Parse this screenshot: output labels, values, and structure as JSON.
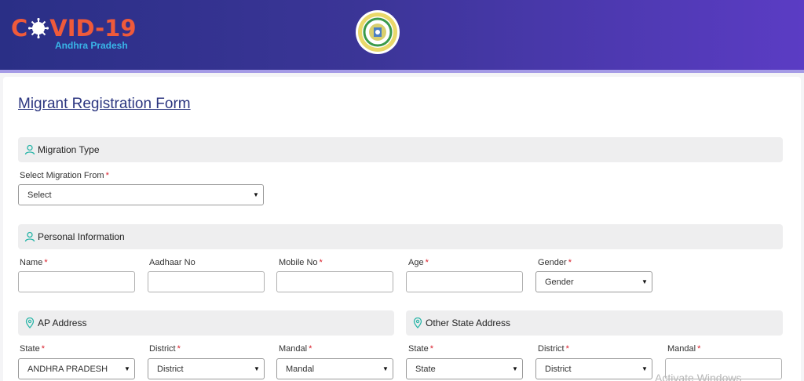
{
  "header": {
    "logo": {
      "prefix": "C",
      "suffix": "VID-19",
      "subtitle": "Andhra Pradesh"
    },
    "emblem_icon": "andhra-pradesh-emblem"
  },
  "colors": {
    "header_start": "#2a2f86",
    "header_end": "#5b3cc4",
    "logo_red": "#ef5a3a",
    "logo_blue": "#39b6e8",
    "required": "#d9202c",
    "title": "#2c3680"
  },
  "form": {
    "title": "Migrant Registration Form",
    "migration_type": {
      "section_label": "Migration Type",
      "section_icon": "person-icon",
      "select_label": "Select Migration From",
      "select_value": "Select"
    },
    "personal_information": {
      "section_label": "Personal Information",
      "section_icon": "person-icon",
      "name_label": "Name",
      "aadhaar_label": "Aadhaar No",
      "mobile_label": "Mobile No",
      "age_label": "Age",
      "gender_label": "Gender",
      "gender_value": "Gender"
    },
    "ap_address": {
      "section_label": "AP Address",
      "section_icon": "location-pin-icon",
      "state_label": "State",
      "state_value": "ANDHRA PRADESH",
      "district_label": "District",
      "district_value": "District",
      "mandal_label": "Mandal",
      "mandal_value": "Mandal"
    },
    "other_state_address": {
      "section_label": "Other State Address",
      "section_icon": "location-pin-icon",
      "state_label": "State",
      "state_value": "State",
      "district_label": "District",
      "district_value": "District",
      "mandal_label": "Mandal"
    },
    "required_mark": "*",
    "caret": "▼"
  },
  "watermark": "Activate Windows"
}
